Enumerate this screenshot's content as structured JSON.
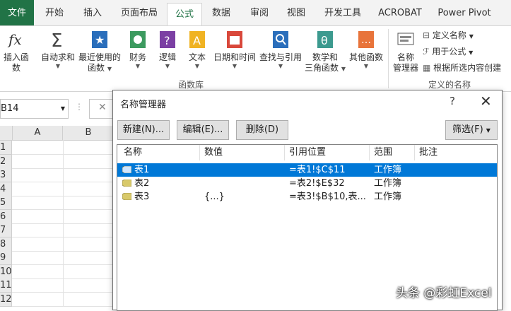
{
  "ribbon_tabs": [
    "文件",
    "开始",
    "插入",
    "页面布局",
    "公式",
    "数据",
    "审阅",
    "视图",
    "开发工具",
    "ACROBAT",
    "Power Pivot"
  ],
  "active_tab": "公式",
  "function_library": {
    "insert_function": "插入函数",
    "autosum": "自动求和",
    "recent_line1": "最近使用的",
    "recent_line2": "函数",
    "financial": "财务",
    "logical": "逻辑",
    "text": "文本",
    "datetime": "日期和时间",
    "lookup": "查找与引用",
    "math_line1": "数学和",
    "math_line2": "三角函数",
    "other": "其他函数",
    "group_label": "函数库"
  },
  "defined_names": {
    "name_manager_line1": "名称",
    "name_manager_line2": "管理器",
    "define_name": "定义名称",
    "use_in_formula": "用于公式",
    "create_from_selection": "根据所选内容创建",
    "group_label": "定义的名称"
  },
  "formula_bar": {
    "name_box": "B14"
  },
  "grid": {
    "columns": [
      "A",
      "B"
    ],
    "rows": [
      "1",
      "2",
      "3",
      "4",
      "5",
      "6",
      "7",
      "8",
      "9",
      "10",
      "11",
      "12"
    ]
  },
  "dialog": {
    "title": "名称管理器",
    "help": "?",
    "close": "✕",
    "buttons": {
      "new": "新建(N)...",
      "edit": "编辑(E)...",
      "delete": "删除(D)",
      "filter": "筛选(F)"
    },
    "columns": [
      "名称",
      "数值",
      "引用位置",
      "范围",
      "批注"
    ],
    "rows": [
      {
        "name": "表1",
        "value": "",
        "refers_to": "=表1!$C$11",
        "scope": "工作簿",
        "comment": "",
        "selected": true
      },
      {
        "name": "表2",
        "value": "",
        "refers_to": "=表2!$E$32",
        "scope": "工作簿",
        "comment": "",
        "selected": false
      },
      {
        "name": "表3",
        "value": "{...}",
        "refers_to": "=表3!$B$10,表...",
        "scope": "工作簿",
        "comment": "",
        "selected": false
      }
    ]
  },
  "watermark": "头条 @彩虹Excel",
  "colors": {
    "excel_green": "#217346",
    "selection_blue": "#0078d7"
  }
}
